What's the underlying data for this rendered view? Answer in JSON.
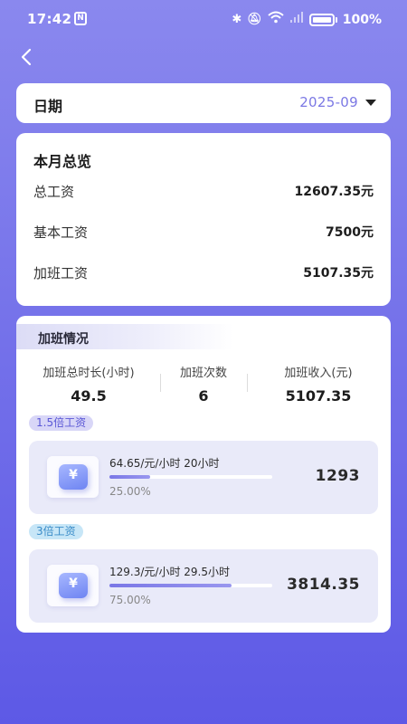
{
  "status_bar": {
    "time": "17:42",
    "nfc_icon": "nfc-icon",
    "battery": "100%",
    "icons": [
      "bluetooth-icon",
      "mute-icon",
      "wifi-icon",
      "signal-icon",
      "battery-charging-icon"
    ]
  },
  "nav": {
    "back_icon": "chevron-left-icon"
  },
  "date_filter": {
    "label": "日期",
    "value": "2025-09",
    "accent": "#7b78e4"
  },
  "summary": {
    "title": "本月总览",
    "rows": [
      {
        "label": "总工资",
        "value": "12607.35元"
      },
      {
        "label": "基本工资",
        "value": "7500元"
      },
      {
        "label": "加班工资",
        "value": "5107.35元"
      }
    ]
  },
  "overtime": {
    "title": "加班情况",
    "stats": [
      {
        "label": "加班总时长(小时)",
        "value": "49.5"
      },
      {
        "label": "加班次数",
        "value": "6"
      },
      {
        "label": "加班收入(元)",
        "value": "5107.35"
      }
    ],
    "tiers": [
      {
        "badge": "1.5倍工资",
        "badge_bg": "#d8d6f7",
        "badge_color": "#5a57d6",
        "rate": "64.65/元/小时 20小时",
        "progress": 0.25,
        "percent": "25.00%",
        "amount": "1293"
      },
      {
        "badge": "3倍工资",
        "badge_bg": "#c7e6f7",
        "badge_color": "#3a8cc8",
        "rate": "129.3/元/小时 29.5小时",
        "progress": 0.75,
        "percent": "75.00%",
        "amount": "3814.35"
      }
    ]
  }
}
